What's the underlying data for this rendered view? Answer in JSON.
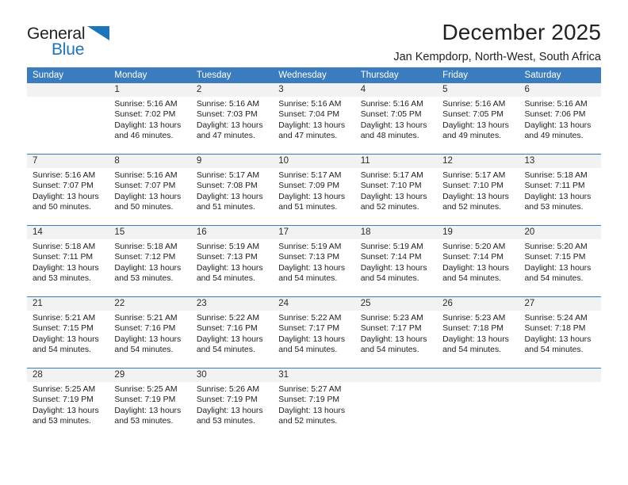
{
  "brand": {
    "name_part1": "General",
    "name_part2": "Blue",
    "logo_icon": "triangle-icon",
    "accent_color": "#1b75bb"
  },
  "header": {
    "month_title": "December 2025",
    "location": "Jan Kempdorp, North-West, South Africa"
  },
  "calendar": {
    "header_bg": "#3a7cbe",
    "daynum_bg": "#f2f2f2",
    "weekday_headers": [
      "Sunday",
      "Monday",
      "Tuesday",
      "Wednesday",
      "Thursday",
      "Friday",
      "Saturday"
    ],
    "weeks": [
      [
        {
          "day": "",
          "lines": []
        },
        {
          "day": "1",
          "lines": [
            "Sunrise: 5:16 AM",
            "Sunset: 7:02 PM",
            "Daylight: 13 hours",
            "and 46 minutes."
          ]
        },
        {
          "day": "2",
          "lines": [
            "Sunrise: 5:16 AM",
            "Sunset: 7:03 PM",
            "Daylight: 13 hours",
            "and 47 minutes."
          ]
        },
        {
          "day": "3",
          "lines": [
            "Sunrise: 5:16 AM",
            "Sunset: 7:04 PM",
            "Daylight: 13 hours",
            "and 47 minutes."
          ]
        },
        {
          "day": "4",
          "lines": [
            "Sunrise: 5:16 AM",
            "Sunset: 7:05 PM",
            "Daylight: 13 hours",
            "and 48 minutes."
          ]
        },
        {
          "day": "5",
          "lines": [
            "Sunrise: 5:16 AM",
            "Sunset: 7:05 PM",
            "Daylight: 13 hours",
            "and 49 minutes."
          ]
        },
        {
          "day": "6",
          "lines": [
            "Sunrise: 5:16 AM",
            "Sunset: 7:06 PM",
            "Daylight: 13 hours",
            "and 49 minutes."
          ]
        }
      ],
      [
        {
          "day": "7",
          "lines": [
            "Sunrise: 5:16 AM",
            "Sunset: 7:07 PM",
            "Daylight: 13 hours",
            "and 50 minutes."
          ]
        },
        {
          "day": "8",
          "lines": [
            "Sunrise: 5:16 AM",
            "Sunset: 7:07 PM",
            "Daylight: 13 hours",
            "and 50 minutes."
          ]
        },
        {
          "day": "9",
          "lines": [
            "Sunrise: 5:17 AM",
            "Sunset: 7:08 PM",
            "Daylight: 13 hours",
            "and 51 minutes."
          ]
        },
        {
          "day": "10",
          "lines": [
            "Sunrise: 5:17 AM",
            "Sunset: 7:09 PM",
            "Daylight: 13 hours",
            "and 51 minutes."
          ]
        },
        {
          "day": "11",
          "lines": [
            "Sunrise: 5:17 AM",
            "Sunset: 7:10 PM",
            "Daylight: 13 hours",
            "and 52 minutes."
          ]
        },
        {
          "day": "12",
          "lines": [
            "Sunrise: 5:17 AM",
            "Sunset: 7:10 PM",
            "Daylight: 13 hours",
            "and 52 minutes."
          ]
        },
        {
          "day": "13",
          "lines": [
            "Sunrise: 5:18 AM",
            "Sunset: 7:11 PM",
            "Daylight: 13 hours",
            "and 53 minutes."
          ]
        }
      ],
      [
        {
          "day": "14",
          "lines": [
            "Sunrise: 5:18 AM",
            "Sunset: 7:11 PM",
            "Daylight: 13 hours",
            "and 53 minutes."
          ]
        },
        {
          "day": "15",
          "lines": [
            "Sunrise: 5:18 AM",
            "Sunset: 7:12 PM",
            "Daylight: 13 hours",
            "and 53 minutes."
          ]
        },
        {
          "day": "16",
          "lines": [
            "Sunrise: 5:19 AM",
            "Sunset: 7:13 PM",
            "Daylight: 13 hours",
            "and 54 minutes."
          ]
        },
        {
          "day": "17",
          "lines": [
            "Sunrise: 5:19 AM",
            "Sunset: 7:13 PM",
            "Daylight: 13 hours",
            "and 54 minutes."
          ]
        },
        {
          "day": "18",
          "lines": [
            "Sunrise: 5:19 AM",
            "Sunset: 7:14 PM",
            "Daylight: 13 hours",
            "and 54 minutes."
          ]
        },
        {
          "day": "19",
          "lines": [
            "Sunrise: 5:20 AM",
            "Sunset: 7:14 PM",
            "Daylight: 13 hours",
            "and 54 minutes."
          ]
        },
        {
          "day": "20",
          "lines": [
            "Sunrise: 5:20 AM",
            "Sunset: 7:15 PM",
            "Daylight: 13 hours",
            "and 54 minutes."
          ]
        }
      ],
      [
        {
          "day": "21",
          "lines": [
            "Sunrise: 5:21 AM",
            "Sunset: 7:15 PM",
            "Daylight: 13 hours",
            "and 54 minutes."
          ]
        },
        {
          "day": "22",
          "lines": [
            "Sunrise: 5:21 AM",
            "Sunset: 7:16 PM",
            "Daylight: 13 hours",
            "and 54 minutes."
          ]
        },
        {
          "day": "23",
          "lines": [
            "Sunrise: 5:22 AM",
            "Sunset: 7:16 PM",
            "Daylight: 13 hours",
            "and 54 minutes."
          ]
        },
        {
          "day": "24",
          "lines": [
            "Sunrise: 5:22 AM",
            "Sunset: 7:17 PM",
            "Daylight: 13 hours",
            "and 54 minutes."
          ]
        },
        {
          "day": "25",
          "lines": [
            "Sunrise: 5:23 AM",
            "Sunset: 7:17 PM",
            "Daylight: 13 hours",
            "and 54 minutes."
          ]
        },
        {
          "day": "26",
          "lines": [
            "Sunrise: 5:23 AM",
            "Sunset: 7:18 PM",
            "Daylight: 13 hours",
            "and 54 minutes."
          ]
        },
        {
          "day": "27",
          "lines": [
            "Sunrise: 5:24 AM",
            "Sunset: 7:18 PM",
            "Daylight: 13 hours",
            "and 54 minutes."
          ]
        }
      ],
      [
        {
          "day": "28",
          "lines": [
            "Sunrise: 5:25 AM",
            "Sunset: 7:19 PM",
            "Daylight: 13 hours",
            "and 53 minutes."
          ]
        },
        {
          "day": "29",
          "lines": [
            "Sunrise: 5:25 AM",
            "Sunset: 7:19 PM",
            "Daylight: 13 hours",
            "and 53 minutes."
          ]
        },
        {
          "day": "30",
          "lines": [
            "Sunrise: 5:26 AM",
            "Sunset: 7:19 PM",
            "Daylight: 13 hours",
            "and 53 minutes."
          ]
        },
        {
          "day": "31",
          "lines": [
            "Sunrise: 5:27 AM",
            "Sunset: 7:19 PM",
            "Daylight: 13 hours",
            "and 52 minutes."
          ]
        },
        {
          "day": "",
          "lines": []
        },
        {
          "day": "",
          "lines": []
        },
        {
          "day": "",
          "lines": []
        }
      ]
    ]
  }
}
